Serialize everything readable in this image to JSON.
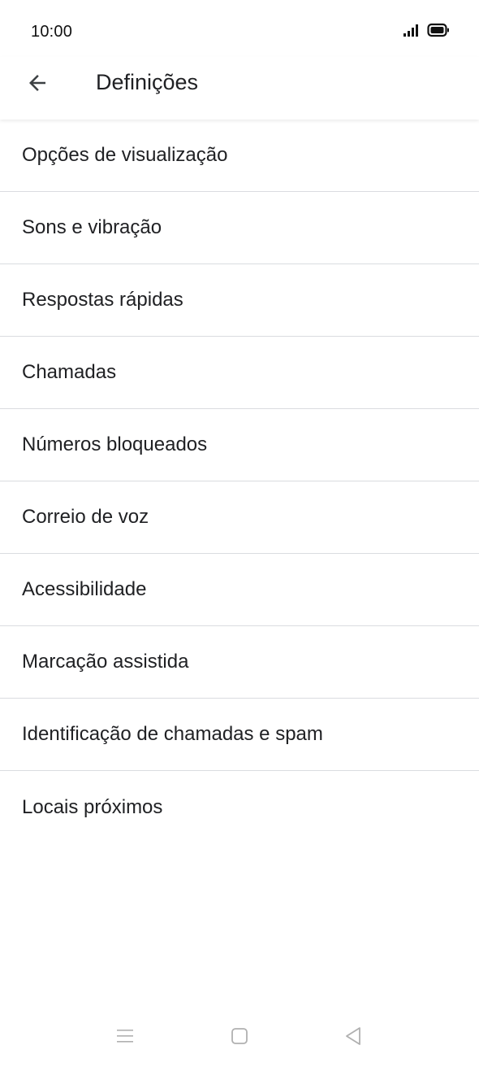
{
  "status_bar": {
    "time": "10:00"
  },
  "toolbar": {
    "title": "Definições"
  },
  "settings": {
    "items": [
      "Opções de visualização",
      "Sons e vibração",
      "Respostas rápidas",
      "Chamadas",
      "Números bloqueados",
      "Correio de voz",
      "Acessibilidade",
      "Marcação assistida",
      "Identificação de chamadas e spam",
      "Locais próximos"
    ]
  },
  "icons": {
    "back": "arrow-back-icon",
    "signal": "signal-icon",
    "battery": "battery-icon",
    "nav_menu": "menu-icon",
    "nav_home": "home-square-icon",
    "nav_back": "back-triangle-icon"
  },
  "colors": {
    "text": "#202124",
    "divider": "#dadce0",
    "nav_icon": "#b0b0b0"
  }
}
